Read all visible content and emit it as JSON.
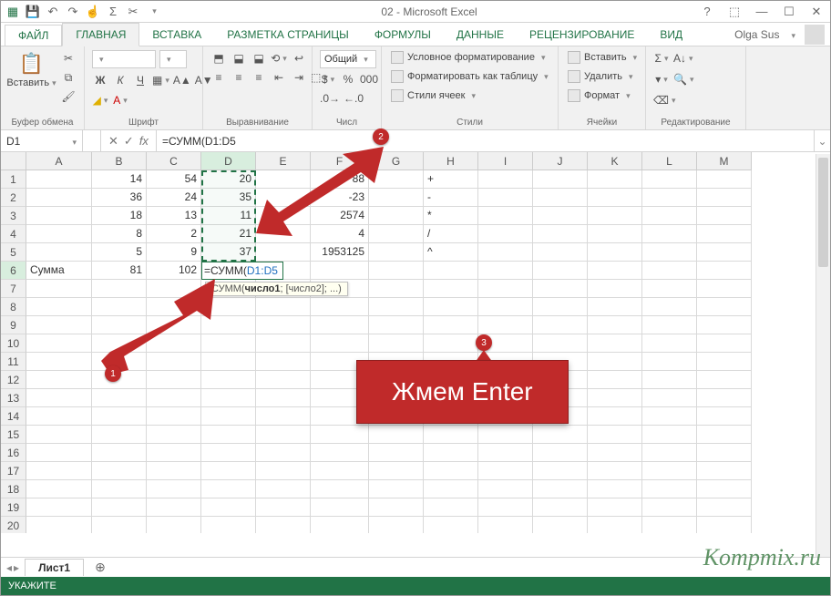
{
  "app_title": "02 - Microsoft Excel",
  "user_name": "Olga Sus",
  "tabs": {
    "file": "ФАЙЛ",
    "items": [
      "ГЛАВНАЯ",
      "ВСТАВКА",
      "РАЗМЕТКА СТРАНИЦЫ",
      "ФОРМУЛЫ",
      "ДАННЫЕ",
      "РЕЦЕНЗИРОВАНИЕ",
      "ВИД"
    ],
    "active_index": 0
  },
  "ribbon_groups": {
    "clipboard": {
      "label": "Буфер обмена",
      "paste": "Вставить"
    },
    "font": {
      "label": "Шрифт"
    },
    "align": {
      "label": "Выравнивание"
    },
    "number": {
      "label": "Числ",
      "format": "Общий"
    },
    "styles": {
      "label": "Стили",
      "cond": "Условное форматирование",
      "table": "Форматировать как таблицу",
      "cell": "Стили ячеек"
    },
    "cells": {
      "label": "Ячейки",
      "ins": "Вставить",
      "del": "Удалить",
      "fmt": "Формат"
    },
    "editing": {
      "label": "Редактирование"
    }
  },
  "formula_bar": {
    "namebox": "D1",
    "fx": "fx",
    "value": "=СУММ(D1:D5"
  },
  "columns": [
    "A",
    "B",
    "C",
    "D",
    "E",
    "F",
    "G",
    "H",
    "I",
    "J",
    "K",
    "L",
    "M"
  ],
  "rows_shown": 20,
  "active_row": 6,
  "active_col": "D",
  "data": {
    "r1": {
      "B": "14",
      "C": "54",
      "D": "20",
      "F": "88",
      "H": "+"
    },
    "r2": {
      "B": "36",
      "C": "24",
      "D": "35",
      "F": "-23",
      "H": "-"
    },
    "r3": {
      "B": "18",
      "C": "13",
      "D": "11",
      "F": "2574",
      "H": "*"
    },
    "r4": {
      "B": "8",
      "C": "2",
      "D": "21",
      "F": "4",
      "H": "/"
    },
    "r5": {
      "B": "5",
      "C": "9",
      "D": "37",
      "F": "1953125",
      "H": "^"
    },
    "r6": {
      "A": "Сумма",
      "B": "81",
      "C": "102"
    }
  },
  "editing_cell": {
    "display": "=СУММ(",
    "ref": "D1:D5"
  },
  "tooltip": {
    "fn": "СУММ(",
    "args": "число1",
    "rest": "; [число2]; ...)"
  },
  "sheet_tabs": {
    "active": "Лист1",
    "add": "⊕"
  },
  "status_text": "УКАЖИТЕ",
  "callouts": {
    "step1": "1",
    "step2": "2",
    "step3": "3",
    "enter": "Жмем Enter"
  },
  "watermark": "Kompmix.ru"
}
